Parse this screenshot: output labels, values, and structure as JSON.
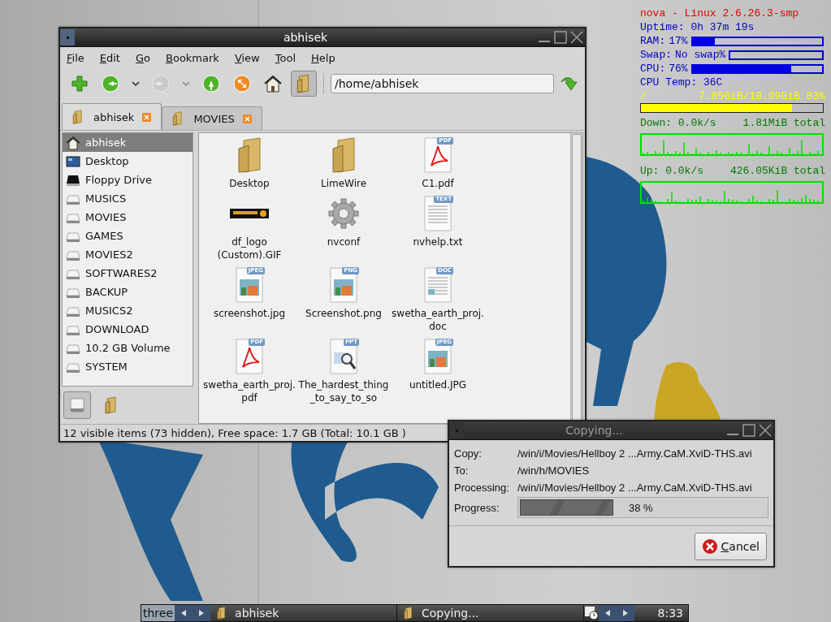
{
  "system_monitor": {
    "title": "nova - Linux 2.6.26.3-smp",
    "uptime": "Uptime: 0h 37m 19s",
    "meters": [
      {
        "label": "RAM:",
        "reading": "17%",
        "level": 0.17
      },
      {
        "label": "Swap:",
        "reading": "No swap%",
        "level": 0
      },
      {
        "label": "CPU:",
        "reading": "76%",
        "level": 0.76
      }
    ],
    "temperature": "CPU Temp: 36C",
    "disk": {
      "mount": "/",
      "usage": "7.85GiB/10.09GiB 83%",
      "level": 0.83
    },
    "network": [
      {
        "rate": "Down: 0.0k/s",
        "total": "1.81MiB total"
      },
      {
        "rate": "Up: 0.0k/s",
        "total": "426.05KiB total"
      }
    ]
  },
  "file_manager": {
    "title": "abhisek",
    "active": true,
    "menu": [
      "File",
      "Edit",
      "Go",
      "Bookmark",
      "View",
      "Tool",
      "Help"
    ],
    "toolbar": [
      {
        "kind": "new-tab",
        "disabled": false,
        "pressed": false
      },
      {
        "kind": "back",
        "disabled": false,
        "pressed": false
      },
      {
        "kind": "history",
        "disabled": false,
        "pressed": false
      },
      {
        "kind": "forward",
        "disabled": true,
        "pressed": false
      },
      {
        "kind": "history",
        "disabled": true,
        "pressed": false
      },
      {
        "kind": "up",
        "disabled": false,
        "pressed": false
      },
      {
        "kind": "orange",
        "disabled": false,
        "pressed": false
      },
      {
        "kind": "home",
        "disabled": false,
        "pressed": false
      },
      {
        "kind": "side-pane",
        "disabled": false,
        "pressed": true
      }
    ],
    "address": "/home/abhisek",
    "tabs": [
      {
        "label": "abhisek",
        "selected": true
      },
      {
        "label": "MOVIES",
        "selected": false
      }
    ],
    "sidebar": [
      {
        "label": "abhisek",
        "kind": "home",
        "selected": true
      },
      {
        "label": "Desktop",
        "kind": "desktop",
        "selected": false
      },
      {
        "label": "Floppy Drive",
        "kind": "floppy",
        "selected": false
      },
      {
        "label": "MUSICS",
        "kind": "drive",
        "selected": false
      },
      {
        "label": "MOVIES",
        "kind": "drive",
        "selected": false
      },
      {
        "label": "GAMES",
        "kind": "drive",
        "selected": false
      },
      {
        "label": "MOVIES2",
        "kind": "drive",
        "selected": false
      },
      {
        "label": "SOFTWARES2",
        "kind": "drive",
        "selected": false
      },
      {
        "label": "BACKUP",
        "kind": "drive",
        "selected": false
      },
      {
        "label": "MUSICS2",
        "kind": "drive",
        "selected": false
      },
      {
        "label": "DOWNLOAD",
        "kind": "drive",
        "selected": false
      },
      {
        "label": "10.2 GB Volume",
        "kind": "drive",
        "selected": false
      },
      {
        "label": "SYSTEM",
        "kind": "drive",
        "selected": false
      }
    ],
    "pane_modes": [
      {
        "kind": "places",
        "selected": true
      },
      {
        "kind": "tree",
        "selected": false
      }
    ],
    "files": [
      {
        "name": "Desktop",
        "kind": "folder"
      },
      {
        "name": "LimeWire",
        "kind": "folder"
      },
      {
        "name": "C1.pdf",
        "kind": "pdf",
        "badge": "PDF"
      },
      {
        "name": "df_logo (Custom).GIF",
        "kind": "logo"
      },
      {
        "name": "nvconf",
        "kind": "settings"
      },
      {
        "name": "nvhelp.txt",
        "kind": "text",
        "badge": "TEXT"
      },
      {
        "name": "screenshot.jpg",
        "kind": "image",
        "badge": "JPEG"
      },
      {
        "name": "Screenshot.png",
        "kind": "image",
        "badge": "PNG"
      },
      {
        "name": "swetha_earth_proj.doc",
        "kind": "doc",
        "badge": "DOC"
      },
      {
        "name": "swetha_earth_proj.pdf",
        "kind": "pdf",
        "badge": "PDF"
      },
      {
        "name": "The_hardest_thing_to_say_to_so",
        "kind": "ppt",
        "badge": "PPT"
      },
      {
        "name": "untitled.JPG",
        "kind": "image",
        "badge": "JPEG"
      }
    ],
    "status": "12 visible items (73 hidden), Free space: 1.7 GB (Total: 10.1 GB )"
  },
  "copy_dialog": {
    "title": "Copying...",
    "active": false,
    "rows": [
      {
        "label": "Copy:",
        "value": "/win/i/Movies/Hellboy 2 ...Army.CaM.XviD-THS.avi"
      },
      {
        "label": "To:",
        "value": "/win/h/MOVIES"
      },
      {
        "label": "Processing:",
        "value": "/win/i/Movies/Hellboy 2 ...Army.CaM.XviD-THS.avi"
      }
    ],
    "progress": {
      "label": "Progress:",
      "level": 0.38,
      "reading": "38 %"
    },
    "cancel": "Cancel"
  },
  "taskbar": {
    "desktop": "three",
    "tasks": [
      "abhisek",
      "Copying..."
    ],
    "clock": "8:33"
  }
}
